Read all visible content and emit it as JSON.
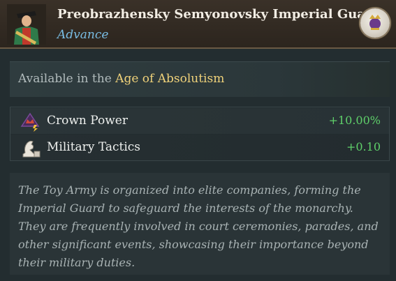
{
  "header": {
    "title": "Preobrazhensky Semyonovsky Imperial Guard",
    "subtitle": "Advance",
    "portrait_icon": "soldier-portrait",
    "emblem_icon": "royal-emblem"
  },
  "availability": {
    "prefix": "Available in the",
    "age": "Age of Absolutism"
  },
  "modifiers": [
    {
      "icon": "crown-power-icon",
      "label": "Crown Power",
      "value": "+10.00%"
    },
    {
      "icon": "military-tactics-icon",
      "label": "Military Tactics",
      "value": "+0.10"
    }
  ],
  "description": "The Toy Army is organized into elite companies, forming the Imperial Guard to safeguard the interests of the monarchy. They are frequently involved in court ceremonies, parades, and other significant events, showcasing their importance beyond their military duties.",
  "colors": {
    "positive": "#5fd06a",
    "age_highlight": "#f0d27a",
    "subtitle": "#79bde4"
  }
}
